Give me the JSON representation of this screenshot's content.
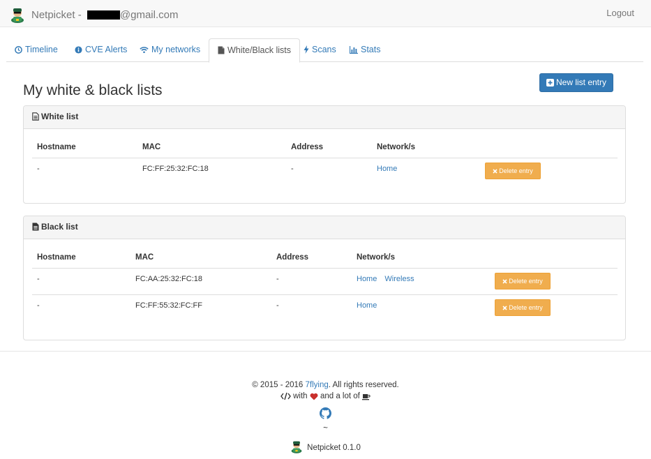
{
  "navbar": {
    "brand_name": "Netpicket",
    "brand_sep": " - ",
    "email_suffix": "@gmail.com",
    "logout": "Logout"
  },
  "tabs": [
    {
      "label": "Timeline",
      "icon": "clock-icon"
    },
    {
      "label": "CVE Alerts",
      "icon": "info-circle-icon"
    },
    {
      "label": "My networks",
      "icon": "wifi-icon"
    },
    {
      "label": "White/Black lists",
      "icon": "file-icon",
      "active": true
    },
    {
      "label": "Scans",
      "icon": "bolt-icon"
    },
    {
      "label": "Stats",
      "icon": "bar-chart-icon"
    }
  ],
  "page": {
    "title": "My white & black lists",
    "new_entry_label": "New list entry"
  },
  "columns": {
    "hostname": "Hostname",
    "mac": "MAC",
    "address": "Address",
    "networks": "Network/s"
  },
  "white_list": {
    "title": "White list",
    "rows": [
      {
        "hostname": "-",
        "mac": "FC:FF:25:32:FC:18",
        "address": "-",
        "networks": [
          "Home"
        ],
        "delete_label": "Delete entry"
      }
    ]
  },
  "black_list": {
    "title": "Black list",
    "rows": [
      {
        "hostname": "-",
        "mac": "FC:AA:25:32:FC:18",
        "address": "-",
        "networks": [
          "Home",
          "Wireless"
        ],
        "delete_label": "Delete entry"
      },
      {
        "hostname": "-",
        "mac": "FC:FF:55:32:FC:FF",
        "address": "-",
        "networks": [
          "Home"
        ],
        "delete_label": "Delete entry"
      }
    ]
  },
  "footer": {
    "copyright_pre": "© 2015 - 2016 ",
    "company": "7flying",
    "copyright_post": ". All rights reserved.",
    "with_text": " with ",
    "and_text": " and a lot of ",
    "tilde": "~",
    "version": "Netpicket 0.1.0"
  },
  "colors": {
    "primary": "#337ab7",
    "warning": "#f0ad4e",
    "heart": "#c9302c"
  }
}
